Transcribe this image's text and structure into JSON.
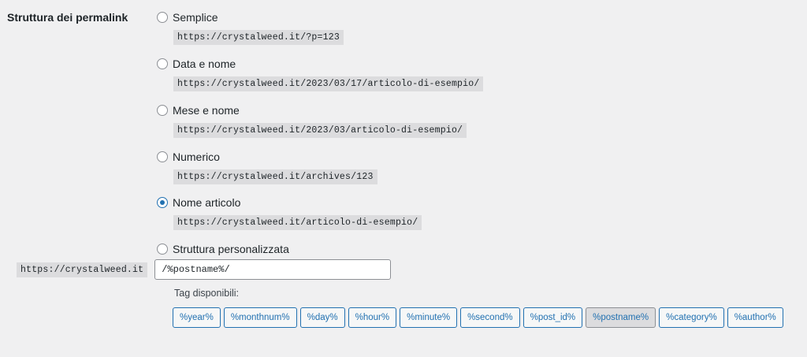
{
  "section_label": "Struttura dei permalink",
  "options": [
    {
      "label": "Semplice",
      "example": "https://crystalweed.it/?p=123",
      "checked": false
    },
    {
      "label": "Data e nome",
      "example": "https://crystalweed.it/2023/03/17/articolo-di-esempio/",
      "checked": false
    },
    {
      "label": "Mese e nome",
      "example": "https://crystalweed.it/2023/03/articolo-di-esempio/",
      "checked": false
    },
    {
      "label": "Numerico",
      "example": "https://crystalweed.it/archives/123",
      "checked": false
    },
    {
      "label": "Nome articolo",
      "example": "https://crystalweed.it/articolo-di-esempio/",
      "checked": true
    }
  ],
  "custom": {
    "label": "Struttura personalizzata",
    "base": "https://crystalweed.it",
    "value": "/%postname%/",
    "checked": false
  },
  "tags_label": "Tag disponibili:",
  "tags": [
    "%year%",
    "%monthnum%",
    "%day%",
    "%hour%",
    "%minute%",
    "%second%",
    "%post_id%",
    "%postname%",
    "%category%",
    "%author%"
  ],
  "active_tag": "%postname%",
  "colors": {
    "accent": "#2271b1",
    "background": "#f0f0f1",
    "code_bg": "#dcdcde"
  }
}
